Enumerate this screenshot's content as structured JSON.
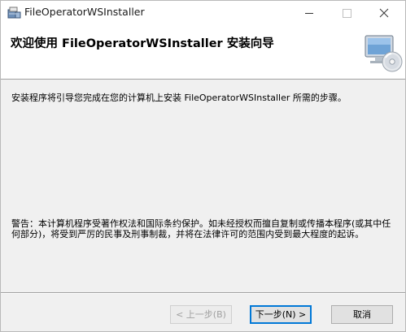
{
  "window": {
    "title": "FileOperatorWSInstaller",
    "icons": {
      "app": "installer-package-icon",
      "minimize": "minimize-icon",
      "maximize": "maximize-icon",
      "close": "close-icon"
    }
  },
  "banner": {
    "title": "欢迎使用 FileOperatorWSInstaller 安装向导",
    "icon": "computer-cd-icon"
  },
  "body": {
    "intro": "安装程序将引导您完成在您的计算机上安装 FileOperatorWSInstaller 所需的步骤。",
    "warning": "警告：本计算机程序受著作权法和国际条约保护。如未经授权而擅自复制或传播本程序(或其中任何部分)，将受到严厉的民事及刑事制裁，并将在法律许可的范围内受到最大程度的起诉。"
  },
  "buttons": {
    "back": "< 上一步(B)",
    "next": "下一步(N) >",
    "cancel": "取消"
  },
  "colors": {
    "window_bg": "#f0f0f0",
    "banner_bg": "#ffffff",
    "default_button_border": "#0078d7"
  }
}
